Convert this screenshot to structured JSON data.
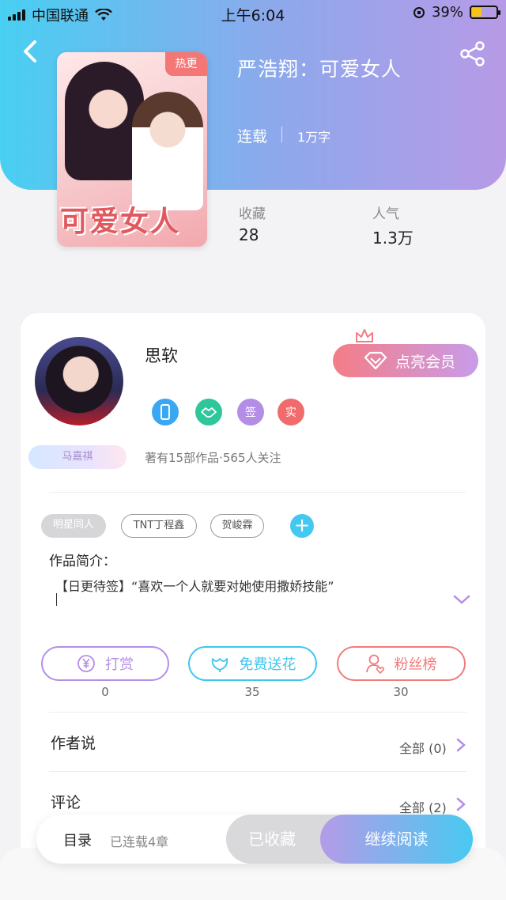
{
  "status_bar": {
    "carrier": "中国联通",
    "time": "上午6:04",
    "battery": "39%",
    "battery_level": 0.39
  },
  "book": {
    "title": "严浩翔：可爱女人",
    "hot_badge": "热更",
    "cover_title": "可爱女人",
    "status": "连载",
    "word_count": "1万字",
    "stats": [
      {
        "label": "收藏",
        "value": "28"
      },
      {
        "label": "人气",
        "value": "1.3万"
      }
    ]
  },
  "author": {
    "name": "思软",
    "vip_button": "点亮会员",
    "badges": [
      {
        "icon": "phone-badge-icon",
        "text": "",
        "color": "#3aa7f2"
      },
      {
        "icon": "handshake-badge-icon",
        "text": "",
        "color": "#2ec79b"
      },
      {
        "icon": "sign-badge-icon",
        "text": "签",
        "color": "#b48ee6"
      },
      {
        "icon": "verified-badge-icon",
        "text": "实",
        "color": "#f06b6b"
      }
    ],
    "fan_badge": "马嘉祺",
    "works_info": "著有15部作品·565人关注"
  },
  "tags": [
    "明星同人",
    "TNT丁程鑫",
    "贺峻霖"
  ],
  "intro": {
    "label": "作品简介：",
    "text": "【日更待签】“喜欢一个人就要对她使用撒娇技能”"
  },
  "actions": [
    {
      "label": "打赏",
      "count": "0",
      "icon": "yen-icon",
      "color": "#b48ee6"
    },
    {
      "label": "免费送花",
      "count": "35",
      "icon": "flower-icon",
      "color": "#3ec6ee"
    },
    {
      "label": "粉丝榜",
      "count": "30",
      "icon": "fan-rank-icon",
      "color": "#f17b7b"
    }
  ],
  "sections": [
    {
      "title": "作者说",
      "right": "全部 (0)"
    },
    {
      "title": "评论",
      "right": "全部 (2)"
    }
  ],
  "bottom_bar": {
    "toc": "目录",
    "chapters": "已连载4章",
    "collected": "已收藏",
    "continue": "继续阅读"
  }
}
